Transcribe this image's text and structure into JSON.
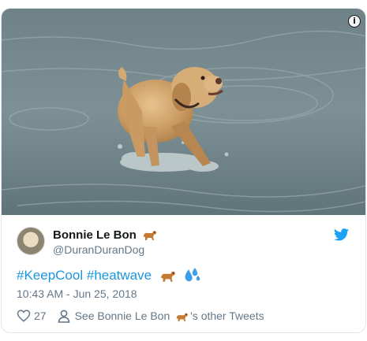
{
  "tweet": {
    "author_name": "Bonnie Le Bon",
    "author_handle": "@DuranDuranDog",
    "hashtag_1": "#KeepCool",
    "hashtag_2": "#heatwave",
    "timestamp": "10:43 AM - Jun 25, 2018",
    "like_count": "27",
    "see_other_prefix": "See Bonnie Le Bon",
    "see_other_suffix": "'s other Tweets",
    "info_label": "i"
  },
  "icons": {
    "info": "info-icon",
    "twitter": "twitter-bird-icon",
    "dog_emoji": "dog-emoji-icon",
    "sweat_emoji": "sweat-droplets-emoji-icon",
    "heart": "heart-icon",
    "person": "person-icon"
  },
  "colors": {
    "link": "#1b95e0",
    "secondary_text": "#657786",
    "border": "#e1e8ed",
    "twitter_blue": "#1da1f2"
  }
}
